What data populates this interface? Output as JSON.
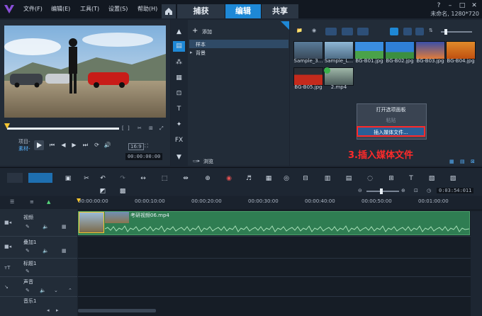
{
  "menu": {
    "items": [
      "文件(F)",
      "编辑(E)",
      "工具(T)",
      "设置(S)",
      "帮助(H)"
    ]
  },
  "tabs": [
    "捕获",
    "编辑",
    "共享"
  ],
  "project": {
    "name": "未命名, 1280*720"
  },
  "preview": {
    "mode_project": "项目-",
    "mode_clip": "素材-",
    "timecode": "00:00:00:00",
    "zoom_label": "16:9"
  },
  "library": {
    "add_label": "添加",
    "folders": [
      "样本",
      "背景"
    ],
    "browse_label": "浏览"
  },
  "media": {
    "items": [
      {
        "name": "Sample_3...",
        "kind": "video"
      },
      {
        "name": "Sample_L...",
        "kind": "video"
      },
      {
        "name": "BG-B01.jpg",
        "kind": "image"
      },
      {
        "name": "BG-B02.jpg",
        "kind": "image"
      },
      {
        "name": "BG-B03.jpg",
        "kind": "image"
      },
      {
        "name": "BG-B04.jpg",
        "kind": "image"
      },
      {
        "name": "BG-B05.jpg",
        "kind": "image"
      },
      {
        "name": "2.mp4",
        "kind": "video"
      }
    ]
  },
  "context_menu": {
    "items": [
      "打开选项面板",
      "粘贴",
      "插入媒体文件..."
    ]
  },
  "annotation": {
    "text": "3.插入媒体文件"
  },
  "timeline": {
    "timecode": "0:03:54:011",
    "ruler": [
      "00:00:00:00",
      "00:00:10:00",
      "00:00:20:00",
      "00:00:30:00",
      "00:00:40:00",
      "00:00:50:00",
      "00:01:00:00"
    ],
    "tracks": [
      "视频",
      "叠加1",
      "标题1",
      "声音",
      "音乐1"
    ],
    "clip_name": "考研视频06.mp4"
  },
  "colors": {
    "accent": "#1e88d6",
    "annotation": "#ff2a2a",
    "clip_green": "#2f7d52"
  }
}
